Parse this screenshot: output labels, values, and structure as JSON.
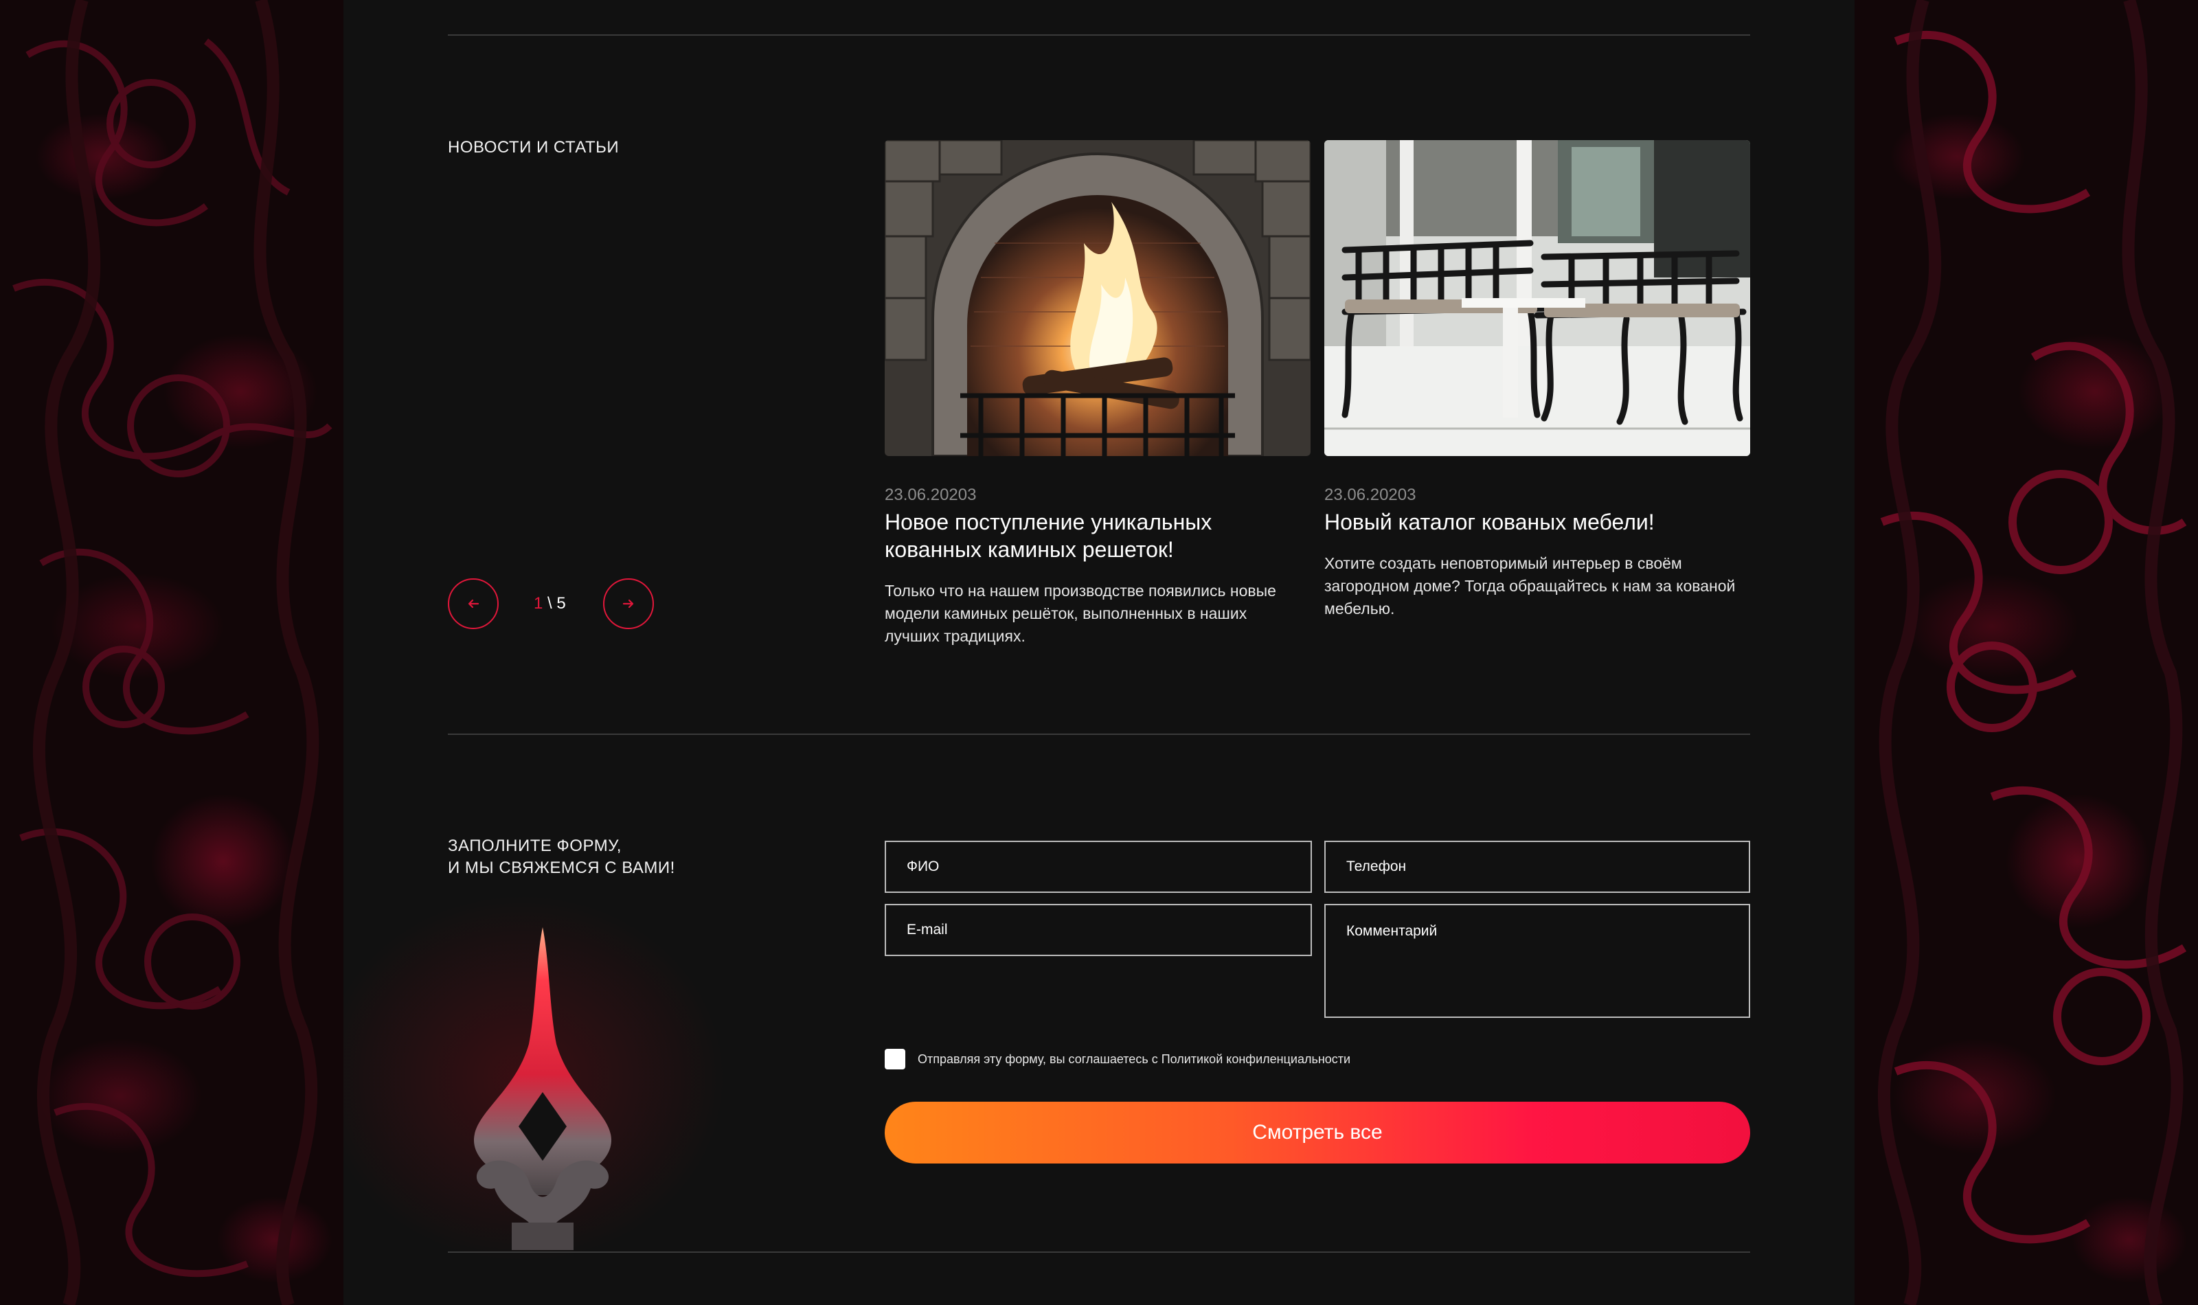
{
  "news": {
    "section_title": "НОВОСТИ И СТАТЬИ",
    "pager": {
      "current": "1",
      "separator": " \\ ",
      "total": "5"
    },
    "prev_icon": "arrow-left-icon",
    "next_icon": "arrow-right-icon",
    "cards": [
      {
        "date": "23.06.20203",
        "title": "Новое поступление уникальных кованных каминых решеток!",
        "text": "Только что на нашем производстве появились новые модели каминых решёток, выполненных в наших лучших традициях.",
        "image": "fireplace-photo"
      },
      {
        "date": "23.06.20203",
        "title": "Новый каталог кованых мебели!",
        "text": "Хотите создать неповторимый интерьер в своём загородном доме? Тогда обращайтесь к нам за кованой мебелью.",
        "image": "wrought-furniture-photo"
      }
    ]
  },
  "form": {
    "title_line1": "ЗАПОЛНИТЕ ФОРМУ,",
    "title_line2": "И МЫ СВЯЖЕМСЯ С ВАМИ!",
    "fields": {
      "name_placeholder": "ФИО",
      "phone_placeholder": "Телефон",
      "email_placeholder": "E-mail",
      "comment_placeholder": "Комментарий"
    },
    "consent_text": "Отправляя эту форму, вы соглашаетесь с Политикой конфиленциальности",
    "submit_label": "Смотреть все",
    "decor_image": "forged-finial-image"
  },
  "colors": {
    "accent": "#e0173a",
    "button_gradient_start": "#ff8519",
    "button_gradient_end": "#f2103e",
    "background": "#111111"
  }
}
